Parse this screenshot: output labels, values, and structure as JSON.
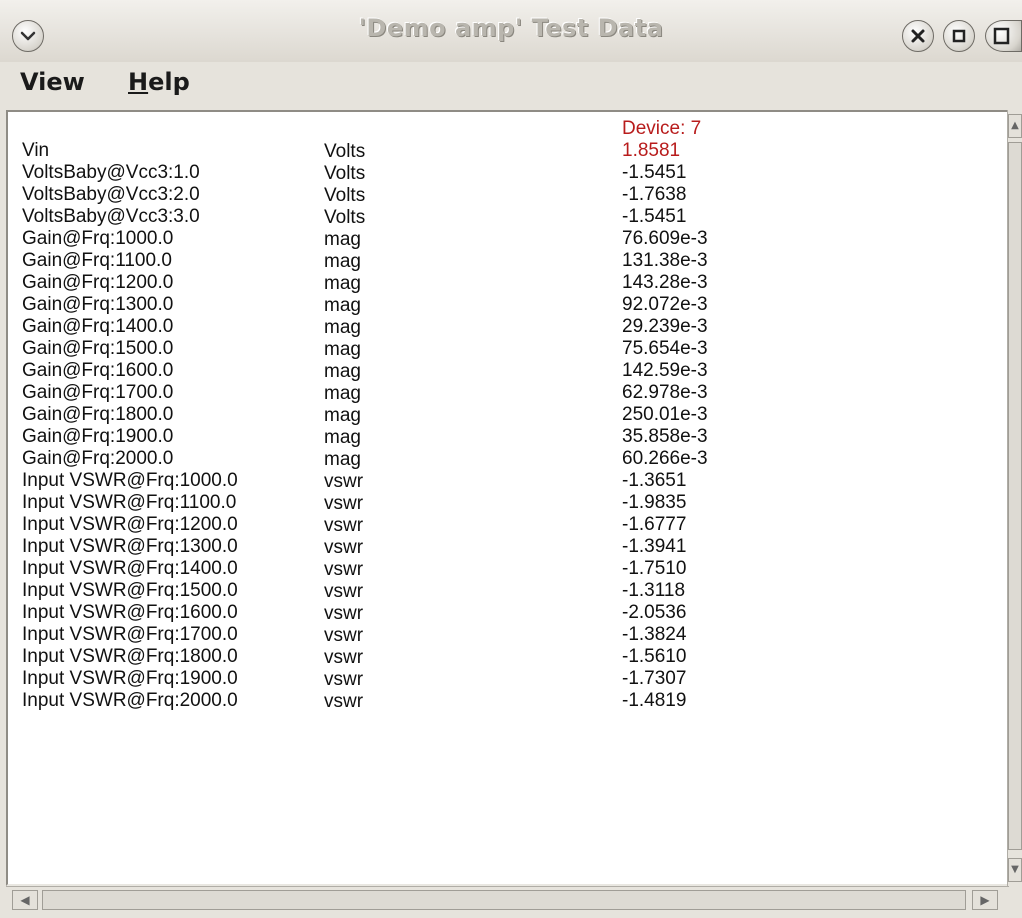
{
  "window": {
    "title": "'Demo amp' Test Data"
  },
  "menu": {
    "view_first": "V",
    "view_rest": "iew",
    "help_first": "H",
    "help_rest": "elp"
  },
  "device_label": "Device: 7",
  "rows": [
    {
      "name": "Vin",
      "unit": "Volts",
      "value": "1.8581"
    },
    {
      "name": "VoltsBaby@Vcc3:1.0",
      "unit": "Volts",
      "value": "-1.5451"
    },
    {
      "name": "VoltsBaby@Vcc3:2.0",
      "unit": "Volts",
      "value": "-1.7638"
    },
    {
      "name": "VoltsBaby@Vcc3:3.0",
      "unit": "Volts",
      "value": "-1.5451"
    },
    {
      "name": "Gain@Frq:1000.0",
      "unit": "mag",
      "value": "76.609e-3"
    },
    {
      "name": "Gain@Frq:1100.0",
      "unit": "mag",
      "value": "131.38e-3"
    },
    {
      "name": "Gain@Frq:1200.0",
      "unit": "mag",
      "value": "143.28e-3"
    },
    {
      "name": "Gain@Frq:1300.0",
      "unit": "mag",
      "value": "92.072e-3"
    },
    {
      "name": "Gain@Frq:1400.0",
      "unit": "mag",
      "value": "29.239e-3"
    },
    {
      "name": "Gain@Frq:1500.0",
      "unit": "mag",
      "value": "75.654e-3"
    },
    {
      "name": "Gain@Frq:1600.0",
      "unit": "mag",
      "value": "142.59e-3"
    },
    {
      "name": "Gain@Frq:1700.0",
      "unit": "mag",
      "value": "62.978e-3"
    },
    {
      "name": "Gain@Frq:1800.0",
      "unit": "mag",
      "value": "250.01e-3"
    },
    {
      "name": "Gain@Frq:1900.0",
      "unit": "mag",
      "value": "35.858e-3"
    },
    {
      "name": "Gain@Frq:2000.0",
      "unit": "mag",
      "value": "60.266e-3"
    },
    {
      "name": "Input VSWR@Frq:1000.0",
      "unit": "vswr",
      "value": "-1.3651"
    },
    {
      "name": "Input VSWR@Frq:1100.0",
      "unit": "vswr",
      "value": "-1.9835"
    },
    {
      "name": "Input VSWR@Frq:1200.0",
      "unit": "vswr",
      "value": "-1.6777"
    },
    {
      "name": "Input VSWR@Frq:1300.0",
      "unit": "vswr",
      "value": "-1.3941"
    },
    {
      "name": "Input VSWR@Frq:1400.0",
      "unit": "vswr",
      "value": "-1.7510"
    },
    {
      "name": "Input VSWR@Frq:1500.0",
      "unit": "vswr",
      "value": "-1.3118"
    },
    {
      "name": "Input VSWR@Frq:1600.0",
      "unit": "vswr",
      "value": "-2.0536"
    },
    {
      "name": "Input VSWR@Frq:1700.0",
      "unit": "vswr",
      "value": "-1.3824"
    },
    {
      "name": "Input VSWR@Frq:1800.0",
      "unit": "vswr",
      "value": "-1.5610"
    },
    {
      "name": "Input VSWR@Frq:1900.0",
      "unit": "vswr",
      "value": "-1.7307"
    },
    {
      "name": "Input VSWR@Frq:2000.0",
      "unit": "vswr",
      "value": "-1.4819"
    }
  ],
  "highlight_color": "#b81c1c",
  "icons": {
    "window_menu": "chevron-down-icon",
    "close": "close-icon",
    "maximize": "maximize-icon",
    "fullscreen": "fullscreen-icon"
  }
}
